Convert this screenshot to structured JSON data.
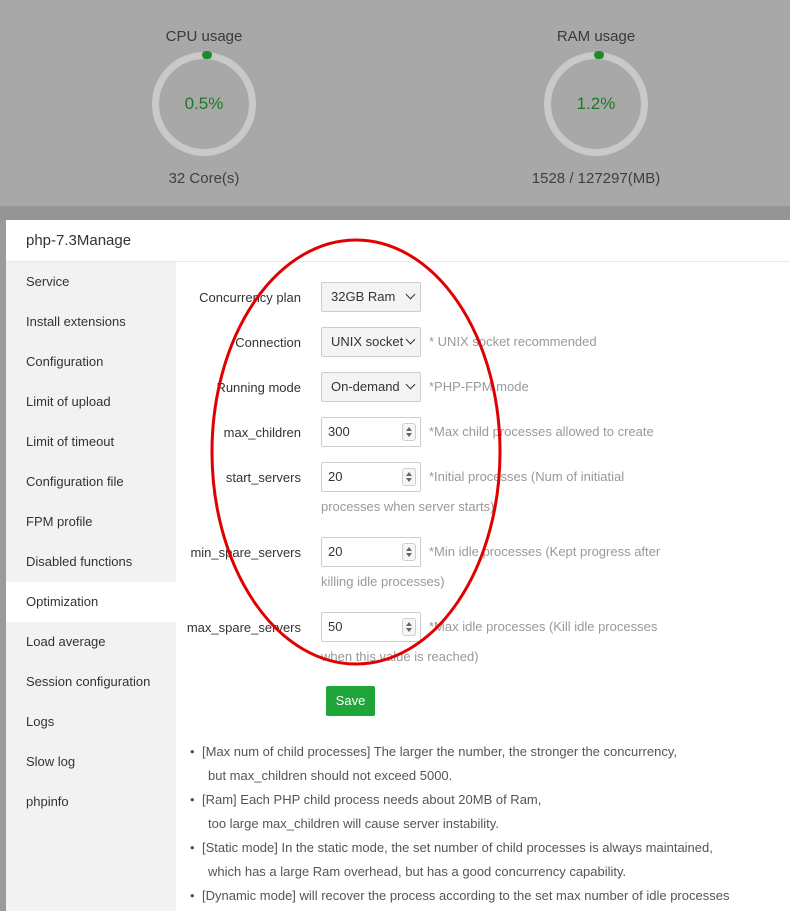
{
  "dashboard": {
    "cpu": {
      "title": "CPU usage",
      "value": "0.5%",
      "sub": "32 Core(s)"
    },
    "ram": {
      "title": "RAM usage",
      "value": "1.2%",
      "sub": "1528 / 127297(MB)"
    }
  },
  "modal": {
    "title": "php-7.3Manage",
    "nav": [
      "Service",
      "Install extensions",
      "Configuration",
      "Limit of upload",
      "Limit of timeout",
      "Configuration file",
      "FPM profile",
      "Disabled functions",
      "Optimization",
      "Load average",
      "Session configuration",
      "Logs",
      "Slow log",
      "phpinfo"
    ],
    "active_nav": "Optimization"
  },
  "form": {
    "concurrency": {
      "label": "Concurrency plan",
      "value": "32GB Ram"
    },
    "connection": {
      "label": "Connection",
      "value": "UNIX socket",
      "hint": "* UNIX socket recommended"
    },
    "running_mode": {
      "label": "Running mode",
      "value": "On-demand",
      "hint": "*PHP-FPM mode"
    },
    "max_children": {
      "label": "max_children",
      "value": "300",
      "hint": "*Max child processes allowed to create"
    },
    "start_servers": {
      "label": "start_servers",
      "value": "20",
      "hint": "*Initial processes (Num of initiatial processes when server starts)"
    },
    "min_spare": {
      "label": "min_spare_servers",
      "value": "20",
      "hint": "*Min idle processes (Kept progress after killing idle processes)"
    },
    "max_spare": {
      "label": "max_spare_servers",
      "value": "50",
      "hint": "*Max idle processes (Kill idle processes when this value is reached)"
    },
    "save_label": "Save"
  },
  "notes": [
    {
      "l1": "[Max num of child processes] The larger the number, the stronger the concurrency,",
      "l2": "but max_children should not exceed 5000."
    },
    {
      "l1": "[Ram] Each PHP child process needs about 20MB of Ram,",
      "l2": "too large max_children will cause server instability."
    },
    {
      "l1": "[Static mode] In the static mode, the set number of child processes is always maintained,",
      "l2": "which has a large Ram overhead, but has a good concurrency capability."
    },
    {
      "l1": "[Dynamic mode] will recover the process according to the set max number of idle processes",
      "l2": ""
    }
  ],
  "colors": {
    "accent": "#20a53a",
    "annotation": "#e00000"
  }
}
